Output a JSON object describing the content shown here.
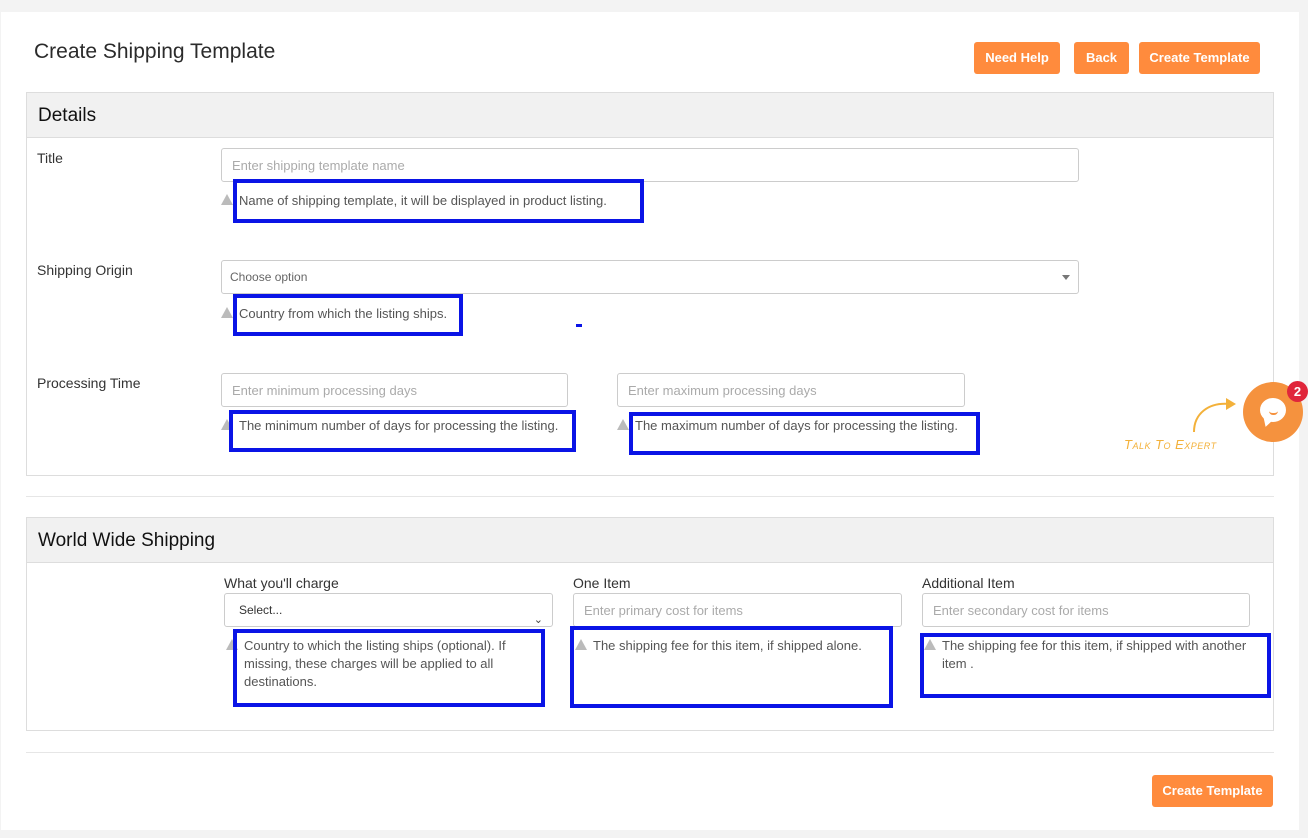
{
  "header": {
    "title": "Create Shipping Template",
    "buttons": {
      "need_help": "Need Help",
      "back": "Back",
      "create_template": "Create Template"
    }
  },
  "details": {
    "heading": "Details",
    "title_field": {
      "label": "Title",
      "placeholder": "Enter shipping template name",
      "value": "",
      "help": "Name of shipping template, it will be displayed in product listing."
    },
    "shipping_origin": {
      "label": "Shipping Origin",
      "selected": "Choose option",
      "help": "Country from which the listing ships."
    },
    "processing_time": {
      "label": "Processing Time",
      "min_placeholder": "Enter minimum processing days",
      "max_placeholder": "Enter maximum processing days",
      "min_help": "The minimum number of days for processing the listing.",
      "max_help": "The maximum number of days for processing the listing."
    }
  },
  "world_wide": {
    "heading": "World Wide Shipping",
    "charge": {
      "label": "What you'll charge",
      "selected": "Select...",
      "help": "Country to which the listing ships (optional). If missing, these charges will be applied to all destinations."
    },
    "one_item": {
      "label": "One Item",
      "placeholder": "Enter primary cost for items",
      "help": "The shipping fee for this item, if shipped alone."
    },
    "additional_item": {
      "label": "Additional Item",
      "placeholder": "Enter secondary cost for items",
      "help": "The shipping fee for this item, if shipped with another item ."
    }
  },
  "footer": {
    "create_template": "Create Template"
  },
  "chat_widget": {
    "label": "Talk To Expert",
    "badge_count": "2",
    "icon": "chat-bubble-icon"
  },
  "colors": {
    "accent": "#ff8b3d",
    "highlight": "#0a14e6",
    "badge": "#e0263b"
  }
}
